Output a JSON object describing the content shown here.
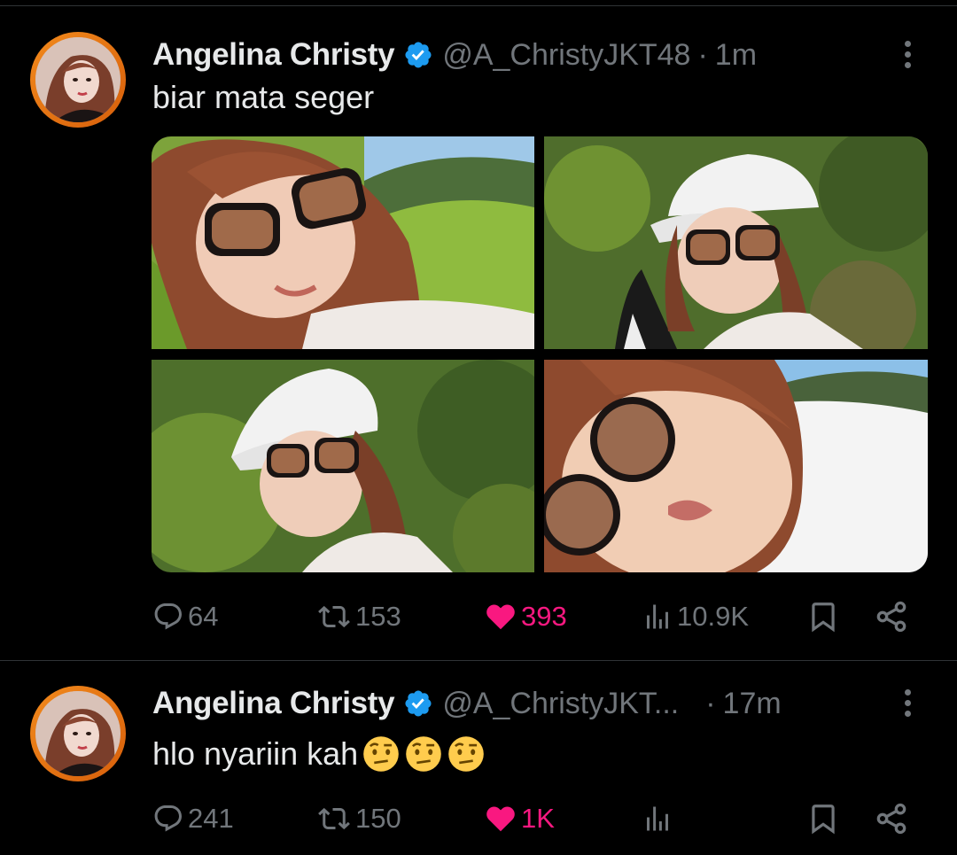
{
  "tweets": [
    {
      "author_name": "Angelina Christy",
      "handle": "@A_ChristyJKT48",
      "separator": "·",
      "time": "1m",
      "text": "biar mata seger",
      "emoji_count": 0,
      "photos": 4,
      "stats": {
        "replies": "64",
        "reposts": "153",
        "likes": "393",
        "views": "10.9K"
      },
      "liked": true
    },
    {
      "author_name": "Angelina Christy",
      "handle": "@A_ChristyJKT...",
      "separator": "·",
      "time": "17m",
      "text": "hlo nyariin kah",
      "emoji_count": 3,
      "emoji": "face-with-raised-eyebrow",
      "photos": 0,
      "stats": {
        "replies": "241",
        "reposts": "150",
        "likes": "1K",
        "views": ""
      },
      "liked": true
    }
  ],
  "colors": {
    "background": "#000000",
    "text": "#e7e9ea",
    "secondary": "#71767b",
    "like": "#f91880",
    "verified": "#1d9bf0",
    "avatar_ring": "#f28a1c",
    "divider": "#2f3336"
  },
  "icons": [
    "verified-badge-icon",
    "more-icon",
    "reply-icon",
    "repost-icon",
    "like-icon",
    "views-icon",
    "bookmark-icon",
    "share-icon"
  ]
}
